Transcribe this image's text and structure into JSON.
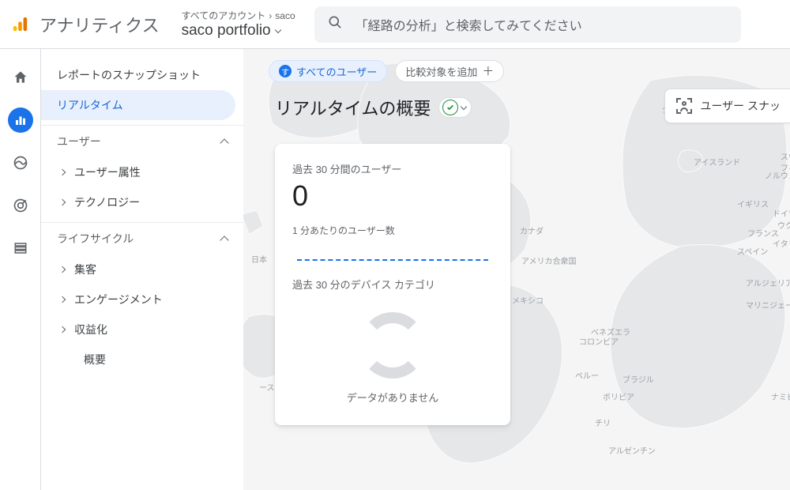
{
  "header": {
    "app_title": "アナリティクス",
    "breadcrumb_top_prefix": "すべてのアカウント",
    "breadcrumb_top_account": "saco",
    "breadcrumb_property": "saco portfolio",
    "search_placeholder": "「経路の分析」と検索してみてください"
  },
  "sidebar": {
    "items": [
      {
        "label": "レポートのスナップショット"
      },
      {
        "label": "リアルタイム"
      }
    ],
    "groups": [
      {
        "label": "ユーザー",
        "items": [
          "ユーザー属性",
          "テクノロジー"
        ]
      },
      {
        "label": "ライフサイクル",
        "items": [
          "集客",
          "エンゲージメント",
          "収益化",
          "概要"
        ]
      }
    ]
  },
  "chips": {
    "all_users_badge": "す",
    "all_users": "すべてのユーザー",
    "add_compare": "比較対象を追加"
  },
  "page": {
    "title": "リアルタイムの概要",
    "snapshot_button": "ユーザー スナッ"
  },
  "card": {
    "heading": "過去 30 分間のユーザー",
    "value": "0",
    "per_minute": "1 分あたりのユーザー数",
    "device_heading": "過去 30 分のデバイス カテゴリ",
    "no_data": "データがありません"
  },
  "map_labels": {
    "greenland": "グリーンランド",
    "canada": "カナダ",
    "usa": "アメリカ合衆国",
    "mexico": "メキシコ",
    "venezuela": "ベネズエラ",
    "colombia": "コロンビア",
    "peru": "ペルー",
    "brazil": "ブラジル",
    "bolivia": "ボリビア",
    "chile": "チリ",
    "argentina": "アルゼンチン",
    "japan": "日本",
    "australia": "ーストラリア",
    "iceland": "アイスランド",
    "norway": "ノルウェー",
    "uk": "イギリス",
    "germany": "ドイツ",
    "france": "フランス",
    "spain": "スペイン",
    "italy": "イタリ",
    "algeria": "アルジェリア",
    "nigeria": "マリニジェール",
    "namibia": "ナミビ",
    "sw": "スウ",
    "fin": "フィン",
    "ukr": "ウクラ"
  }
}
